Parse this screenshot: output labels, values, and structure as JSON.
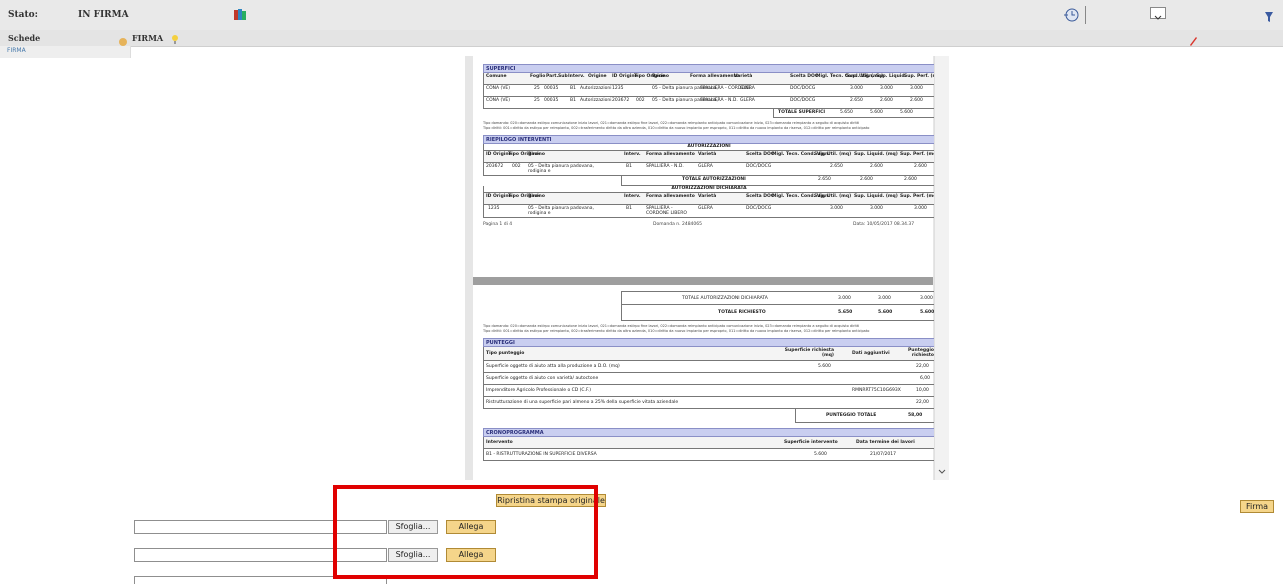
{
  "header": {
    "status_label": "Stato:",
    "status_value": "IN FIRMA"
  },
  "subbar": {
    "schede_label": "Schede",
    "firma_label": "FIRMA"
  },
  "left_tabs": [
    "FIRMA"
  ],
  "document": {
    "superfici": {
      "title": "SUPERFICI",
      "columns": [
        "Comune",
        "Foglio",
        "Part.",
        "Sub",
        "Interv.",
        "Origine",
        "ID Origine",
        "Tipo Origine",
        "Bacino",
        "Forma allevamento",
        "Varietà",
        "Scelta DOC",
        "Migl. Tecn. Cond. Vign.",
        "Sup. Util. (mq)",
        "Sup. Liquid.",
        "Sup. Perf. (mq)"
      ],
      "rows": [
        [
          "CONA (VE)",
          "25",
          "00035",
          "B1",
          "Autorizzazioni",
          "1235",
          "",
          "05 - Delta pianura padovana,",
          "SPALLIERA - CORDONE",
          "GLERA",
          "DOC/DOCG",
          "",
          "3.000",
          "3.000",
          "3.000"
        ],
        [
          "CONA (VE)",
          "25",
          "00035",
          "B1",
          "Autorizzazioni",
          "203672",
          "002",
          "05 - Delta pianura padovana,",
          "SPALLIERA - N.D.",
          "GLERA",
          "DOC/DOCG",
          "",
          "2.650",
          "2.600",
          "2.600"
        ]
      ],
      "total_label": "TOTALE SUPERFICI",
      "total_values": [
        "5.650",
        "5.600",
        "5.600"
      ],
      "note1": "Tipo domanda: 020=domanda estirpo comunicazione inizio lavori, 021=domanda estirpo fine lavori, 022=domanda reimpianto anticipato comunicazione inizio, 023=domanda reimpianto a seguito di acquisto diritti",
      "note2": "Tipo diritti: 001=diritto da estirpo per reimpianto, 002=trasferimento diritto da altra azienda, 010=diritto da nuovo impianto per esproprio, 011=diritto da nuovo impianto da riserva, 012=diritto per reimpianto anticipato"
    },
    "riepilogo": {
      "title": "RIEPILOGO INTERVENTI",
      "autorizzazioni_title": "AUTORIZZAZIONI",
      "columns": [
        "ID Origine",
        "Tipo Origine",
        "Bacino",
        "Interv.",
        "Forma allevamento",
        "Varietà",
        "Scelta DOC",
        "Migl. Tecn. Cond. Vign.",
        "Sup. Util. (mq)",
        "Sup. Liquid. (mq)",
        "Sup. Perf. (mq)"
      ],
      "row1": [
        "203672",
        "002",
        "05 - Delta pianura padovana, rodigina e",
        "B1",
        "SPALLIERA - N.D.",
        "GLERA",
        "DOC/DOCG",
        "",
        "2.650",
        "2.600",
        "2.600"
      ],
      "total_aut_label": "TOTALE AUTORIZZAZIONI",
      "total_aut_values": [
        "2.650",
        "2.600",
        "2.600"
      ],
      "dichiarata_title": "AUTORIZZAZIONI DICHIARATA",
      "row2": [
        "1235",
        "",
        "05 - Delta pianura padovana, rodigina e",
        "B1",
        "SPALLIERA - CORDONE LIBERO",
        "GLERA",
        "DOC/DOCG",
        "",
        "3.000",
        "3.000",
        "3.000"
      ],
      "footer_page": "Pagina 1 di 4",
      "footer_domanda": "Domanda n. 2484065",
      "footer_data": "Data: 10/05/2017 08.34.37"
    },
    "totali": {
      "dichiarata_label": "TOTALE AUTORIZZAZIONI DICHIARATA",
      "dichiarata_values": [
        "3.000",
        "3.000",
        "3.000"
      ],
      "richiesto_label": "TOTALE RICHIESTO",
      "richiesto_values": [
        "5.650",
        "5.600",
        "5.600"
      ]
    },
    "punteggi": {
      "title": "PUNTEGGI",
      "columns": [
        "Tipo punteggio",
        "Superficie richiesta (mq)",
        "Dati aggiuntivi",
        "Punteggio richiesto"
      ],
      "rows": [
        [
          "Superficie oggetto di aiuto atta alla produzione a D.O. (mq)",
          "5.600",
          "",
          "22,00"
        ],
        [
          "Superficie oggetto di aiuto con varietà/ autoctone",
          "",
          "",
          "6,00"
        ],
        [
          "Imprenditore Agricolo Professionale o CD (C.F.)",
          "",
          "RMNRRT75C10G693X",
          "10,00"
        ],
        [
          "Ristrutturazione di una superficie pari almeno a 25% della superficie vitata aziendale",
          "",
          "",
          "22,00"
        ]
      ],
      "total_label": "PUNTEGGIO TOTALE",
      "total_value": "58,00"
    },
    "crono": {
      "title": "CRONOPROGRAMMA",
      "columns": [
        "Intervento",
        "Superficie intervento",
        "Data termine dei lavori"
      ],
      "row": [
        "B1 - RISTRUTTURAZIONE IN SUPERFICIE DIVERSA",
        "5.600",
        "21/07/2017"
      ]
    }
  },
  "actions": {
    "ripristina_label": "Ripristina stampa originale",
    "firma_label": "Firma",
    "sfoglia_label": "Sfoglia...",
    "allega_label": "Allega"
  }
}
